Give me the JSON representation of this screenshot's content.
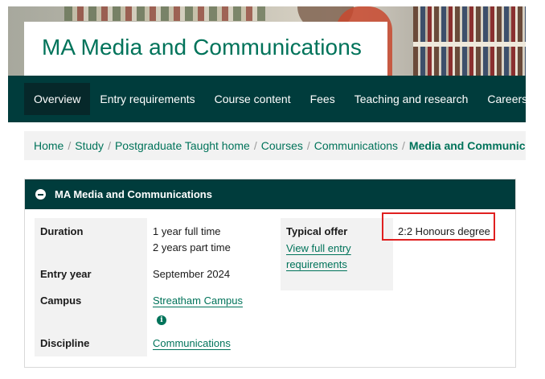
{
  "hero": {
    "title": "MA Media and Communications"
  },
  "nav": {
    "tabs": [
      {
        "label": "Overview",
        "active": true
      },
      {
        "label": "Entry requirements",
        "active": false
      },
      {
        "label": "Course content",
        "active": false
      },
      {
        "label": "Fees",
        "active": false
      },
      {
        "label": "Teaching and research",
        "active": false
      },
      {
        "label": "Careers",
        "active": false
      }
    ]
  },
  "breadcrumb": {
    "items": [
      "Home",
      "Study",
      "Postgraduate Taught home",
      "Courses",
      "Communications"
    ],
    "current": "Media and Communications",
    "separator": "/"
  },
  "panel": {
    "title": "MA Media and Communications",
    "duration_label": "Duration",
    "duration_full": "1 year full time",
    "duration_part": "2 years part time",
    "entry_year_label": "Entry year",
    "entry_year_value": "September 2024",
    "campus_label": "Campus",
    "campus_value": "Streatham Campus",
    "campus_info_icon": "info-icon",
    "discipline_label": "Discipline",
    "discipline_value": "Communications",
    "offer_label": "Typical offer",
    "offer_link": "View full entry requirements",
    "offer_link_line1": "View full entry",
    "offer_link_line2": "requirements",
    "offer_value": "2:2 Honours degree"
  },
  "colors": {
    "brand_green": "#00735a",
    "nav_dark": "#003c3c",
    "highlight_red": "#e02020"
  }
}
